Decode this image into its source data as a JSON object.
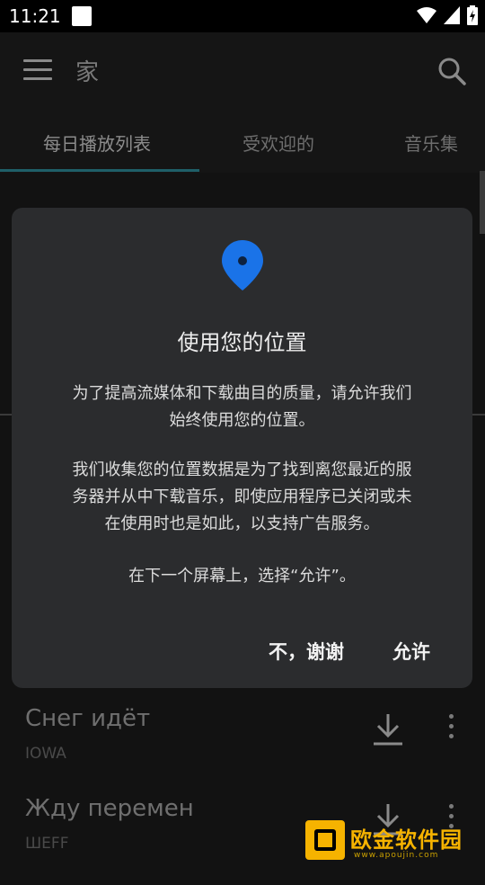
{
  "status_bar": {
    "time": "11:21"
  },
  "app_bar": {
    "title": "家"
  },
  "tabs": [
    {
      "label": "每日播放列表",
      "active": true
    },
    {
      "label": "受欢迎的",
      "active": false
    },
    {
      "label": "音乐集",
      "active": false
    }
  ],
  "songs": [
    {
      "title": "Снег идёт",
      "artist": "IOWA"
    },
    {
      "title": "Жду перемен",
      "artist": "ШEFF"
    }
  ],
  "dialog": {
    "icon": "location-pin-icon",
    "title": "使用您的位置",
    "paragraph1": [
      "为了提高流媒体和下载曲目的质量，请允许我们",
      "始终使用您的位置。"
    ],
    "paragraph2": [
      "我们收集您的位置数据是为了找到离您最近的服",
      "务器并从中下载音乐，即使应用程序已关闭或未",
      "在使用时也是如此，以支持广告服务。"
    ],
    "paragraph3": "在下一个屏幕上，选择“允许”。",
    "deny_label": "不，谢谢",
    "allow_label": "允许"
  },
  "watermark": {
    "text": "欧金软件园",
    "url": "www.apoujin.com"
  },
  "colors": {
    "accent": "#1a73e8",
    "tab_indicator": "#1f5f68",
    "watermark": "#f6b300"
  }
}
